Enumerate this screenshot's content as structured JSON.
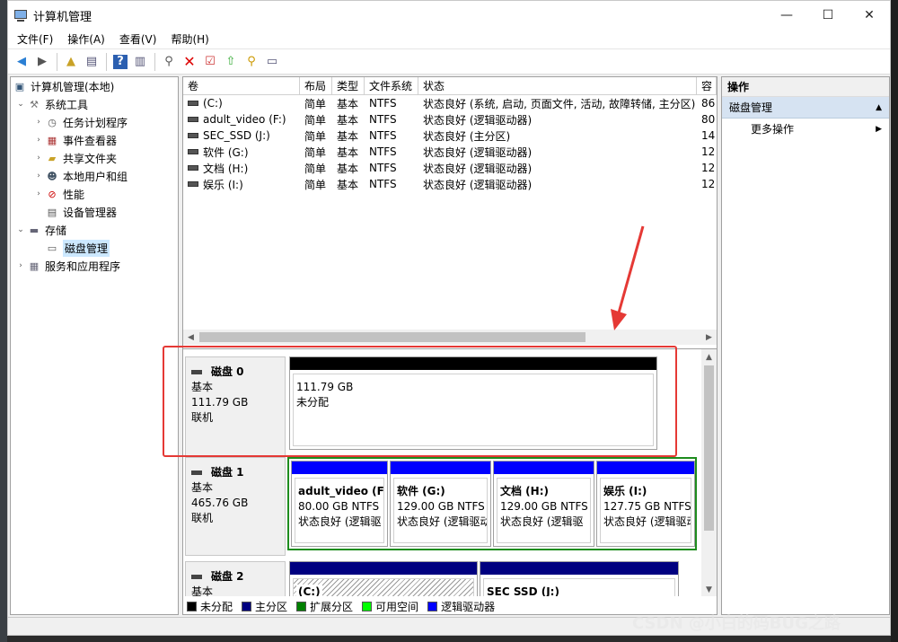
{
  "window": {
    "title": "计算机管理",
    "minimize": "—",
    "maximize": "☐",
    "close": "✕"
  },
  "menu": [
    "文件(F)",
    "操作(A)",
    "查看(V)",
    "帮助(H)"
  ],
  "tree": {
    "root": "计算机管理(本地)",
    "system_tools": "系统工具",
    "task_scheduler": "任务计划程序",
    "event_viewer": "事件查看器",
    "shared_folders": "共享文件夹",
    "local_users": "本地用户和组",
    "performance": "性能",
    "device_manager": "设备管理器",
    "storage": "存储",
    "disk_management": "磁盘管理",
    "services_apps": "服务和应用程序"
  },
  "volume_headers": [
    "卷",
    "布局",
    "类型",
    "文件系统",
    "状态",
    "容"
  ],
  "volumes": [
    {
      "name": "(C:)",
      "layout": "简单",
      "type": "基本",
      "fs": "NTFS",
      "status": "状态良好 (系统, 启动, 页面文件, 活动, 故障转储, 主分区)",
      "cap": "86"
    },
    {
      "name": "adult_video (F:)",
      "layout": "简单",
      "type": "基本",
      "fs": "NTFS",
      "status": "状态良好 (逻辑驱动器)",
      "cap": "80"
    },
    {
      "name": "SEC_SSD (J:)",
      "layout": "简单",
      "type": "基本",
      "fs": "NTFS",
      "status": "状态良好 (主分区)",
      "cap": "14"
    },
    {
      "name": "软件 (G:)",
      "layout": "简单",
      "type": "基本",
      "fs": "NTFS",
      "status": "状态良好 (逻辑驱动器)",
      "cap": "12"
    },
    {
      "name": "文档 (H:)",
      "layout": "简单",
      "type": "基本",
      "fs": "NTFS",
      "status": "状态良好 (逻辑驱动器)",
      "cap": "12"
    },
    {
      "name": "娱乐 (I:)",
      "layout": "简单",
      "type": "基本",
      "fs": "NTFS",
      "status": "状态良好 (逻辑驱动器)",
      "cap": "12"
    }
  ],
  "disks": {
    "disk0": {
      "name": "磁盘 0",
      "type": "基本",
      "size": "111.79 GB",
      "state": "联机",
      "part": {
        "size": "111.79 GB",
        "status": "未分配"
      }
    },
    "disk1": {
      "name": "磁盘 1",
      "type": "基本",
      "size": "465.76 GB",
      "state": "联机",
      "parts": [
        {
          "title": "adult_video (F",
          "size": "80.00 GB NTFS",
          "status": "状态良好 (逻辑驱"
        },
        {
          "title": "软件 (G:)",
          "size": "129.00 GB NTFS",
          "status": "状态良好 (逻辑驱动"
        },
        {
          "title": "文档 (H:)",
          "size": "129.00 GB NTFS",
          "status": "状态良好 (逻辑驱"
        },
        {
          "title": "娱乐 (I:)",
          "size": "127.75 GB NTFS",
          "status": "状态良好 (逻辑驱动"
        }
      ]
    },
    "disk2": {
      "name": "磁盘 2",
      "type": "基本",
      "parts": [
        {
          "title": "(C:)"
        },
        {
          "title": "SEC SSD (J:)"
        }
      ]
    }
  },
  "legend": [
    "未分配",
    "主分区",
    "扩展分区",
    "可用空间",
    "逻辑驱动器"
  ],
  "colors": {
    "unallocated": "#000000",
    "primary": "#000080",
    "extended": "#008000",
    "free": "#00ff00",
    "logical": "#0000ff",
    "highlight": "#e53935"
  },
  "actions": {
    "header": "操作",
    "section": "磁盘管理",
    "more": "更多操作"
  },
  "watermark": "CSDN @小白的码BUG之路"
}
